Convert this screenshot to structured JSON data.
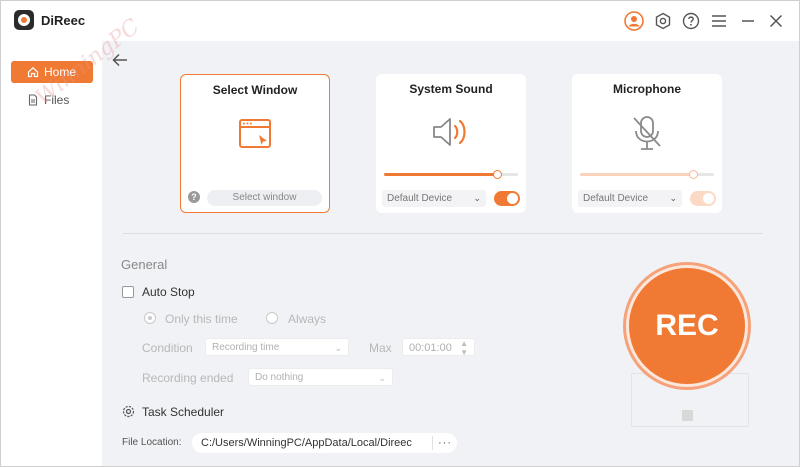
{
  "app": {
    "title": "DiReec"
  },
  "sidebar": {
    "items": [
      {
        "label": "Home",
        "icon": "home-icon",
        "active": true
      },
      {
        "label": "Files",
        "icon": "file-icon",
        "active": false
      }
    ],
    "watermark": "WinningPC"
  },
  "cards": {
    "select_window": {
      "title": "Select Window",
      "button_label": "Select window",
      "help": "?"
    },
    "system_sound": {
      "title": "System Sound",
      "device": "Default Device",
      "volume_fraction": 0.85,
      "enabled": true
    },
    "microphone": {
      "title": "Microphone",
      "device": "Default Device",
      "volume_fraction": 0.85,
      "enabled": false
    }
  },
  "general": {
    "title": "General",
    "auto_stop": {
      "label": "Auto Stop",
      "checked": false
    },
    "mode_options": [
      "Only this time",
      "Always"
    ],
    "condition": {
      "label": "Condition",
      "value": "Recording time",
      "max_label": "Max",
      "max_value": "00:01:00"
    },
    "recording_ended": {
      "label": "Recording ended",
      "value": "Do nothing"
    },
    "task_scheduler": "Task Scheduler",
    "file_location": {
      "label": "File Location:",
      "path": "C:/Users/WinningPC/AppData/Local/Direec",
      "more": "···"
    }
  },
  "rec_button": {
    "label": "REC"
  },
  "colors": {
    "accent": "#f07a33",
    "accent_light": "#f5a27b",
    "toggle_off": "#fcd9c5"
  }
}
